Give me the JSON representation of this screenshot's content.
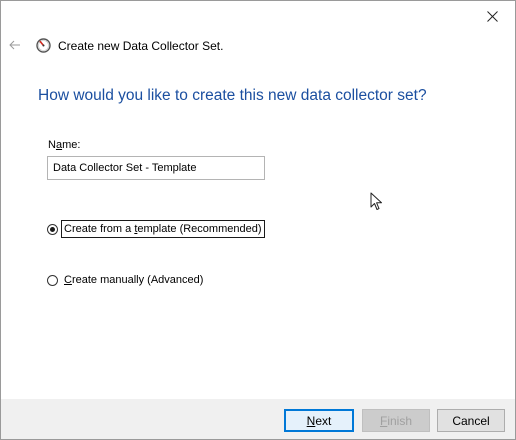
{
  "window": {
    "title": "Create new Data Collector Set.",
    "heading": "How would you like to create this new data collector set?"
  },
  "icons": {
    "close": "close-icon",
    "back": "back-arrow-icon",
    "app": "performance-monitor-icon",
    "cursor": "mouse-pointer-icon"
  },
  "form": {
    "name_label_prefix": "N",
    "name_label_accel": "a",
    "name_label_suffix": "me:",
    "name_value": "Data Collector Set - Template",
    "options": [
      {
        "pre": "Create from a ",
        "accel": "t",
        "post": "emplate (Recommended)",
        "selected": true
      },
      {
        "pre": "",
        "accel": "C",
        "post": "reate manually (Advanced)",
        "selected": false
      }
    ]
  },
  "buttons": {
    "next": {
      "accel": "N",
      "rest": "ext"
    },
    "finish": {
      "accel": "F",
      "rest": "inish",
      "disabled": true
    },
    "cancel": {
      "label": "Cancel"
    }
  },
  "colors": {
    "heading": "#1b4fa0",
    "footer_bg": "#f0f0f0",
    "default_button_border": "#0078d7"
  }
}
